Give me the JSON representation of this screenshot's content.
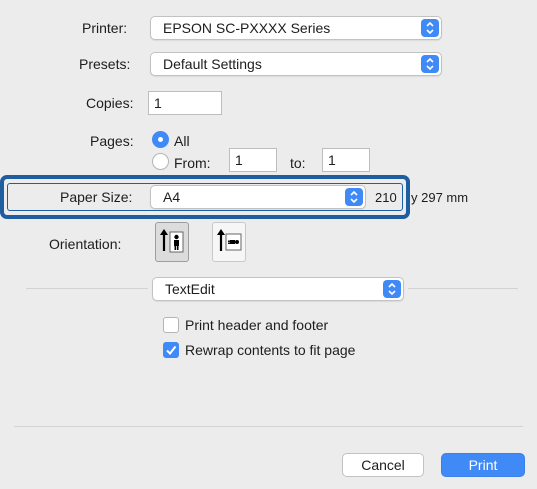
{
  "printer": {
    "label": "Printer:",
    "value": "EPSON SC-PXXXX Series"
  },
  "presets": {
    "label": "Presets:",
    "value": "Default Settings"
  },
  "copies": {
    "label": "Copies:",
    "value": "1"
  },
  "pages": {
    "label": "Pages:",
    "all_label": "All",
    "from_label": "From:",
    "from_value": "1",
    "to_label": "to:",
    "to_value": "1",
    "selected": "All"
  },
  "paper_size": {
    "label": "Paper Size:",
    "value": "A4",
    "dims_part1": "210",
    "dims_part2": "y 297 mm"
  },
  "orientation": {
    "label": "Orientation:",
    "selected": "portrait"
  },
  "app_menu": {
    "value": "TextEdit"
  },
  "options": [
    {
      "label": "Print header and footer",
      "checked": false
    },
    {
      "label": "Rewrap contents to fit page",
      "checked": true
    }
  ],
  "buttons": {
    "cancel": "Cancel",
    "print": "Print"
  },
  "colors": {
    "accent": "#3f8af7",
    "highlight": "#1d5da0",
    "panel": "#ececec"
  },
  "icons": [
    "up-down-arrows-icon",
    "portrait-orientation-icon",
    "landscape-orientation-icon",
    "checkmark-icon"
  ]
}
